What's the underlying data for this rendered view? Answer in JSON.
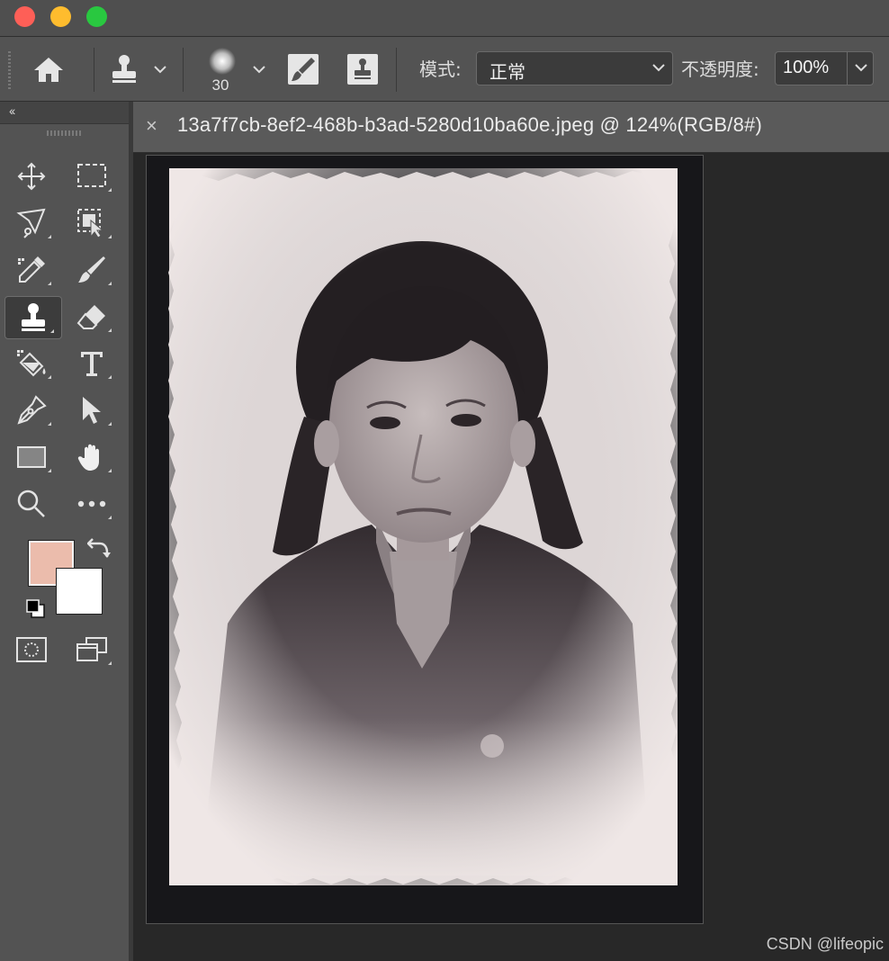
{
  "window": {
    "buttons": [
      "close",
      "minimize",
      "maximize"
    ]
  },
  "options_bar": {
    "home_icon": "home-icon",
    "tool_icon": "clone-stamp-icon",
    "brush_size": "30",
    "mode_label": "模式:",
    "mode_value": "正常",
    "opacity_label": "不透明度:",
    "opacity_value": "100%"
  },
  "document": {
    "tab_title": "13a7f7cb-8ef2-468b-b3ad-5280d10ba60e.jpeg @ 124%(RGB/8#)",
    "close_symbol": "×"
  },
  "tools_panel": {
    "collapse_symbol": "‹‹",
    "tools": [
      "move-tool",
      "marquee-tool",
      "lasso-tool",
      "object-selection-tool",
      "eyedropper-tool",
      "brush-tool",
      "clone-stamp-tool",
      "eraser-tool",
      "paint-bucket-tool",
      "type-tool",
      "pen-tool",
      "path-selection-tool",
      "rectangle-tool",
      "hand-tool",
      "zoom-tool",
      "more-tools",
      "quick-mask-tool",
      "screen-mode-tool"
    ],
    "active_tool": "clone-stamp-tool",
    "foreground_color": "#ebbcac",
    "background_color": "#ffffff"
  },
  "watermark": "CSDN @lifeopic"
}
